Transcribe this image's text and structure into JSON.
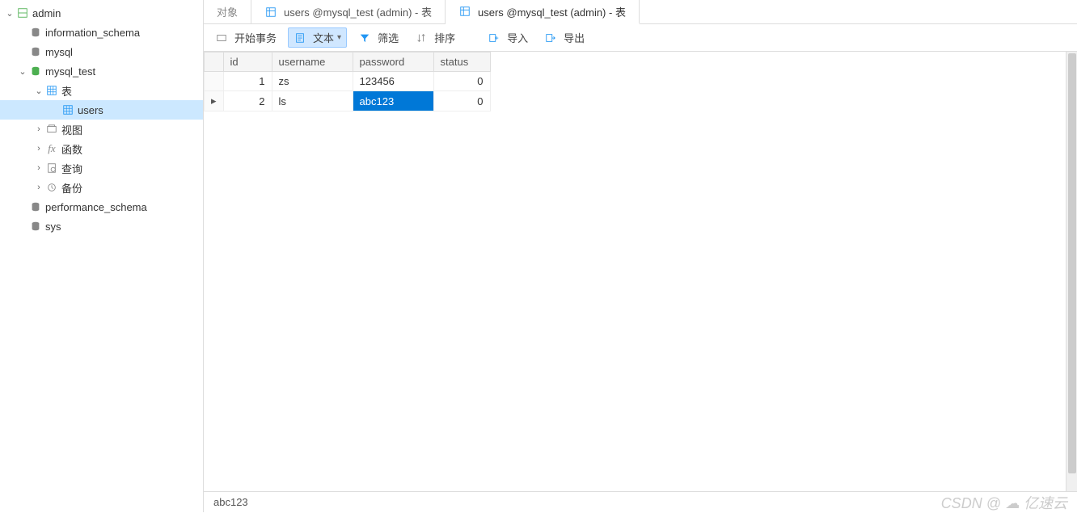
{
  "tree": {
    "root": "admin",
    "items": [
      "information_schema",
      "mysql",
      "mysql_test",
      "表",
      "users",
      "视图",
      "函数",
      "查询",
      "备份",
      "performance_schema",
      "sys"
    ]
  },
  "tabs": {
    "t0": "对象",
    "t1": "users @mysql_test (admin) - 表",
    "t2": "users @mysql_test (admin) - 表"
  },
  "toolbar": {
    "begin": "开始事务",
    "text": "文本",
    "filter": "筛选",
    "sort": "排序",
    "import": "导入",
    "export": "导出"
  },
  "columns": {
    "c0": "id",
    "c1": "username",
    "c2": "password",
    "c3": "status"
  },
  "rows": [
    {
      "id": "1",
      "username": "zs",
      "password": "123456",
      "status": "0"
    },
    {
      "id": "2",
      "username": "ls",
      "password": "abc123",
      "status": "0"
    }
  ],
  "status": {
    "cell": "abc123",
    "wm1": "CSDN @",
    "wm2": "亿速云"
  },
  "selected_row": 1,
  "selected_col": "password"
}
